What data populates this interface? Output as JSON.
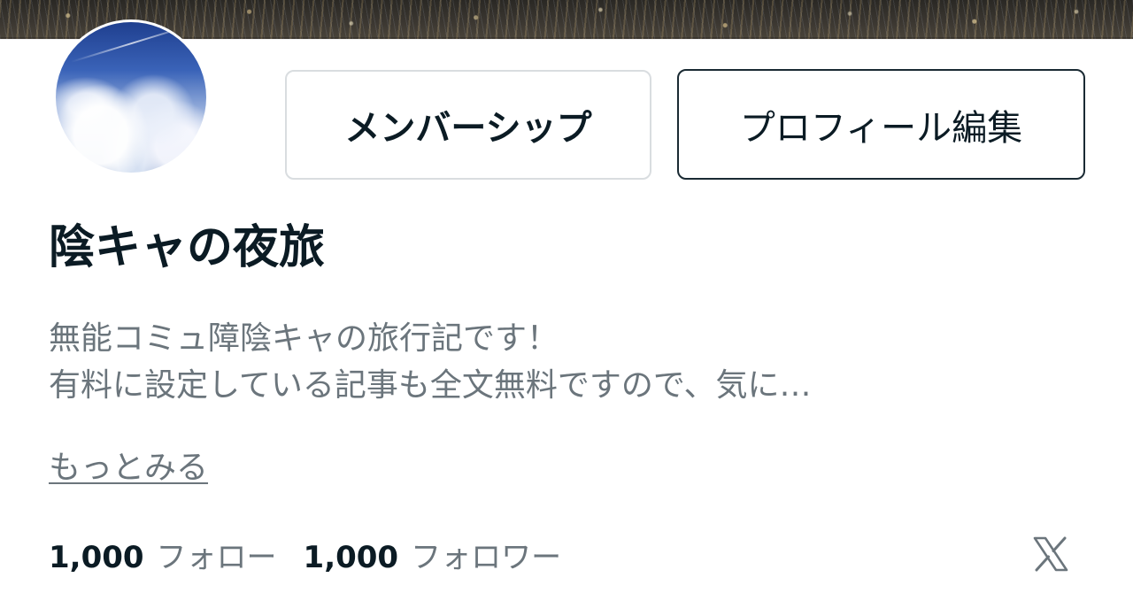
{
  "profile": {
    "name": "陰キャの夜旅",
    "bio_lines": [
      "無能コミュ障陰キャの旅行記です！",
      "有料に設定している記事も全文無料ですので、気に…"
    ],
    "more_label": "もっとみる"
  },
  "buttons": {
    "membership_label": "メンバーシップ",
    "edit_profile_label": "プロフィール編集"
  },
  "stats": {
    "following_count": "1,000",
    "following_label": "フォロー",
    "followers_count": "1,000",
    "followers_label": "フォロワー"
  },
  "icons": {
    "social": "x-logo-icon"
  },
  "colors": {
    "text_primary": "#0b1b24",
    "text_secondary": "#6b757c",
    "button_border_light": "#d9dde0",
    "button_border_dark": "#1a2a33"
  }
}
